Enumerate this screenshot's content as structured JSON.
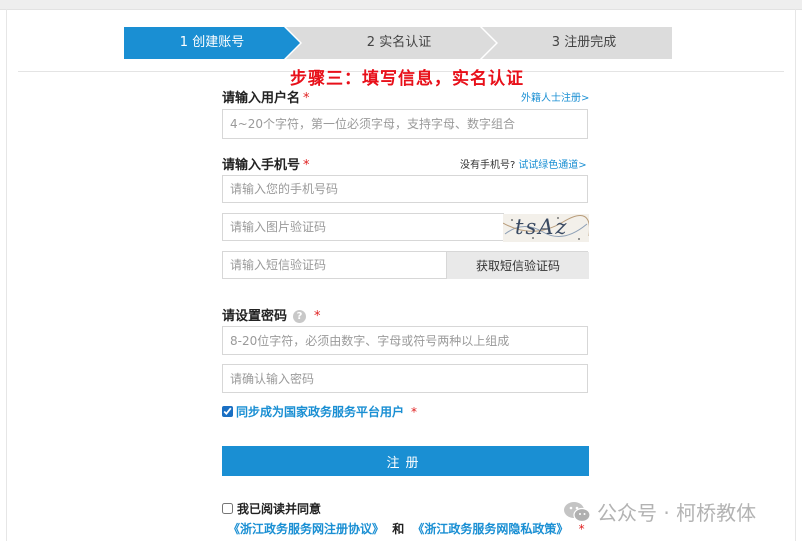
{
  "steps": [
    {
      "label": "1 创建账号",
      "active": true
    },
    {
      "label": "2 实名认证",
      "active": false
    },
    {
      "label": "3 注册完成",
      "active": false
    }
  ],
  "annotation": "步骤三：填写信息，实名认证",
  "username": {
    "label": "请输入用户名",
    "required_mark": "*",
    "foreign_link": "外籍人士注册>",
    "placeholder": "4~20个字符，第一位必须字母，支持字母、数字组合"
  },
  "phone": {
    "label": "请输入手机号",
    "required_mark": "*",
    "no_phone_text": "没有手机号?",
    "green_channel_link": "试试绿色通道>",
    "phone_placeholder": "请输入您的手机号码",
    "image_code_placeholder": "请输入图片验证码",
    "captcha_text": "tsAz",
    "sms_code_placeholder": "请输入短信验证码",
    "sms_button": "获取短信验证码"
  },
  "password": {
    "label": "请设置密码",
    "help_icon_text": "?",
    "required_mark": "*",
    "placeholder": "8-20位字符，必须由数字、字母或符号两种以上组成",
    "confirm_placeholder": "请确认输入密码"
  },
  "sync": {
    "label": "同步成为国家政务服务平台用户",
    "required_mark": "*",
    "checked": true
  },
  "register_button": "注册",
  "agreement": {
    "label": "我已阅读并同意",
    "checked": false,
    "protocol_link": "《浙江政务服务网注册协议》",
    "and_text": "和",
    "privacy_link": "《浙江政务服务网隐私政策》",
    "required_mark": "*"
  },
  "watermark": {
    "icon": "wechat-icon",
    "text": "公众号 · 柯桥教体"
  },
  "colors": {
    "primary": "#1a8fd3",
    "annotation_red": "#e8101a",
    "step_inactive": "#dcdcdc"
  }
}
